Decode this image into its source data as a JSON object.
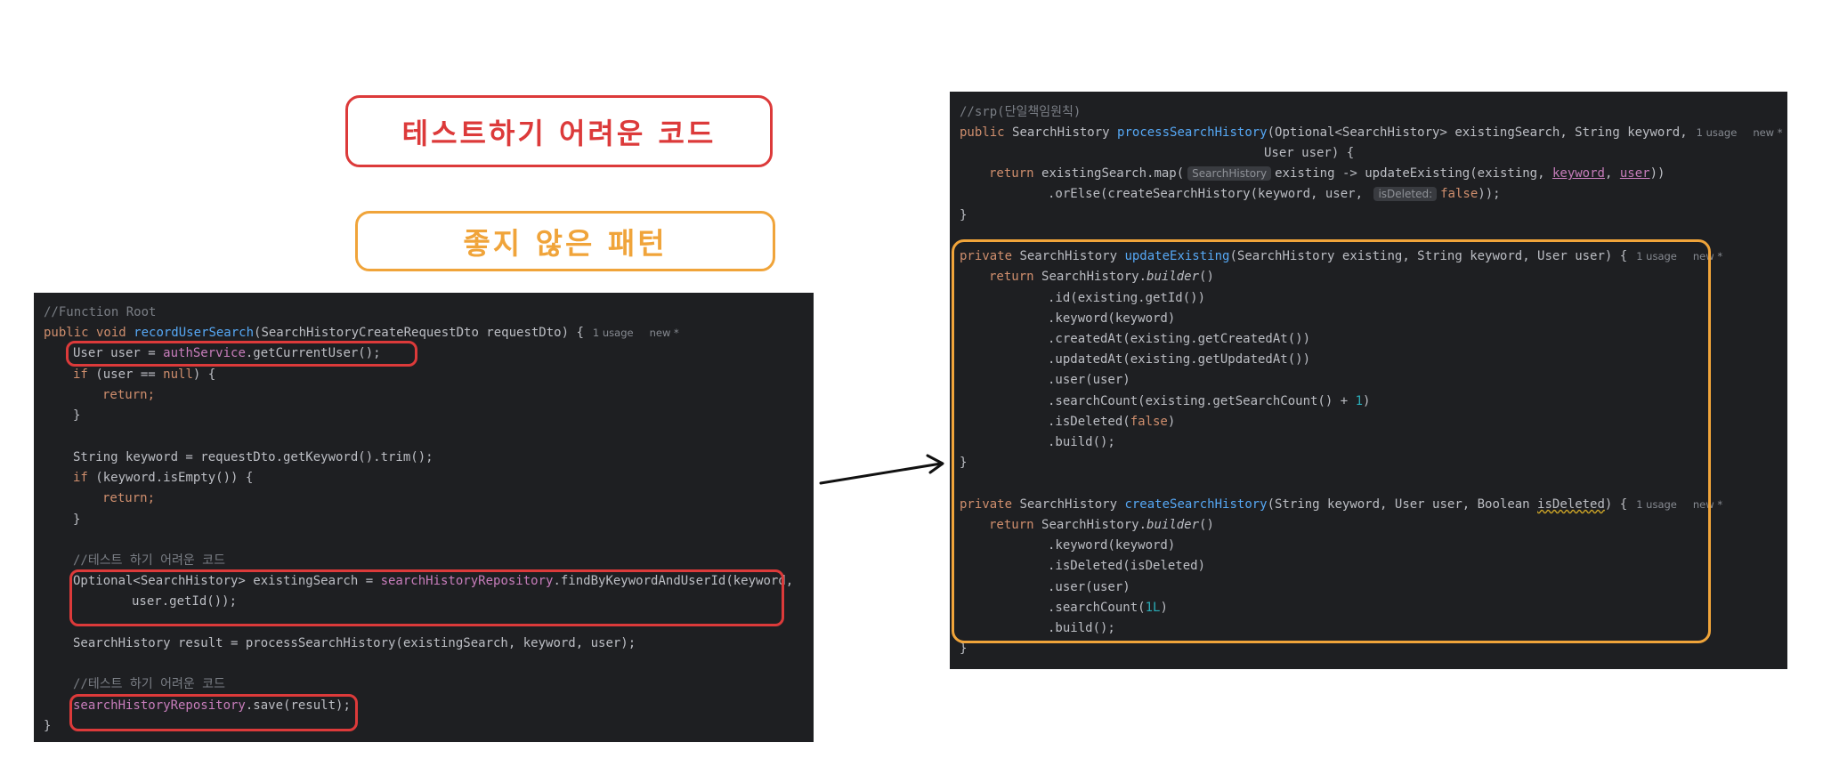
{
  "labels": {
    "hard_to_test": "테스트하기 어려운 코드",
    "bad_pattern": "좋지 않은 패턴"
  },
  "left_code": {
    "l1": "//Function Root",
    "l2": {
      "a": "public void ",
      "b": "recordUserSearch",
      "c": "(SearchHistoryCreateRequestDto requestDto) {",
      "hint1": "1 usage",
      "hint2": "new *"
    },
    "l3": {
      "a": "User user = ",
      "b": "authService",
      "c": ".getCurrentUser();"
    },
    "l4": {
      "a": "if ",
      "b": "(user == ",
      "c": "null",
      "d": ") {"
    },
    "l5": "return;",
    "l6": "}",
    "l7": "String keyword = requestDto.getKeyword().trim();",
    "l8": {
      "a": "if ",
      "b": "(keyword.isEmpty()) {"
    },
    "l9": "return;",
    "l10": "}",
    "l11": "//테스트 하기 어려운 코드",
    "l12": {
      "a": "Optional<SearchHistory> existingSearch = ",
      "b": "searchHistoryRepository",
      "c": ".findByKeywordAndUserId(keyword,"
    },
    "l13": "user.getId());",
    "l14": "SearchHistory result = processSearchHistory(existingSearch, keyword, user);",
    "l15": "//테스트 하기 어려운 코드",
    "l16": {
      "a": "searchHistoryRepository",
      "b": ".save(result);"
    },
    "l17": "}"
  },
  "right_code": {
    "r1": "//srp(단일책임원칙)",
    "r2": {
      "a": "public ",
      "b": "SearchHistory ",
      "c": "processSearchHistory",
      "d": "(Optional<SearchHistory> existingSearch, String keyword,",
      "hint1": "1 usage",
      "hint2": "new *"
    },
    "r3": "User user) {",
    "r4": {
      "a": "return ",
      "b": "existingSearch.map(",
      "inlay": "SearchHistory",
      "c": "existing -> updateExisting(existing, ",
      "d": "keyword",
      "e": ", ",
      "f": "user",
      "g": "))"
    },
    "r5": {
      "a": ".orElse(createSearchHistory(keyword, user, ",
      "inlay": "isDeleted:",
      "b": "false",
      "c": "));"
    },
    "r6": "}",
    "r7": {
      "a": "private ",
      "b": "SearchHistory ",
      "c": "updateExisting",
      "d": "(SearchHistory existing, String keyword, User user) {",
      "hint1": "1 usage",
      "hint2": "new *"
    },
    "r8": {
      "a": "return ",
      "b": "SearchHistory.",
      "c": "builder",
      "d": "()"
    },
    "r9": ".id(existing.getId())",
    "r10": ".keyword(keyword)",
    "r11": ".createdAt(existing.getCreatedAt())",
    "r12": ".updatedAt(existing.getUpdatedAt())",
    "r13": ".user(user)",
    "r14": {
      "a": ".searchCount(existing.getSearchCount() + ",
      "b": "1",
      "c": ")"
    },
    "r15": {
      "a": ".isDeleted(",
      "b": "false",
      "c": ")"
    },
    "r16": ".build();",
    "r17": "}",
    "r18": {
      "a": "private ",
      "b": "SearchHistory ",
      "c": "createSearchHistory",
      "d": "(String keyword, User user, Boolean ",
      "e": "isDeleted",
      "f": ") {",
      "hint1": "1 usage",
      "hint2": "new *"
    },
    "r19": {
      "a": "return ",
      "b": "SearchHistory.",
      "c": "builder",
      "d": "()"
    },
    "r20": ".keyword(keyword)",
    "r21": ".isDeleted(isDeleted)",
    "r22": ".user(user)",
    "r23": {
      "a": ".searchCount(",
      "b": "1L",
      "c": ")"
    },
    "r24": ".build();",
    "r25": "}"
  },
  "colors": {
    "highlight_red": "#dc3a3a",
    "highlight_orange": "#f0a43a",
    "editor_background": "#1e1f22"
  }
}
